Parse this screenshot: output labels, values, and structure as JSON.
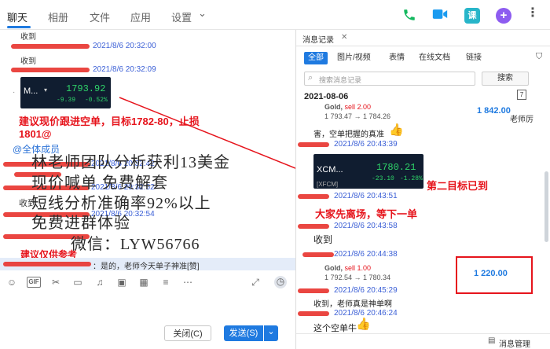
{
  "nav": {
    "tabs": [
      "聊天",
      "相册",
      "文件",
      "应用",
      "设置"
    ],
    "settings_caret": "⌄"
  },
  "top_icons": {
    "phone": "phone-icon",
    "video": "video-icon",
    "class": "课",
    "add": "+",
    "more": "more-icon",
    "accent_colors": {
      "phone": "#14b85f",
      "video": "#1a9bf0",
      "class": "#27b5c9",
      "add": "#8d5cf0"
    }
  },
  "chat": {
    "row1_msg": "收到",
    "row2_ts": "2021/8/6 20:32:00",
    "row3_msg": "收到",
    "row4_ts": "2021/8/6 20:32:09",
    "quote": {
      "symbol": "M...",
      "price": "1793.92",
      "change": "-9.39",
      "change_pct": "-0.52%"
    },
    "advice_line1": "建议现价跟进空单，目标1782-80，止损",
    "advice_line2": "1801@",
    "mention": "@全体成员",
    "ts_a": "2021/8/6 20:32:42",
    "ts_b": "2021/8/6 20:32:52",
    "msg_received": "收到",
    "ts_c": "2021/8/6 20:32:54",
    "suggestion_label": "建议仅供参考",
    "reply_preview": "：是的，老师今天单子神准[赞]"
  },
  "overlay": {
    "line1": "林老师团队分析获利13美金",
    "line2": "现价喊单     免费解套",
    "line3": "短线分析准确率92%以上",
    "line4": "免费进群体验",
    "line5": "微信：LYW56766"
  },
  "toolbar": {
    "gif_label": "GIF",
    "close_label": "关闭(C)",
    "send_label": "发送(S)",
    "send_caret": "⌄"
  },
  "panel": {
    "title": "消息记录",
    "close": "✕",
    "filters": [
      "全部",
      "图片/视频",
      "表情",
      "在线文档",
      "链接"
    ],
    "search_placeholder": "搜索消息记录",
    "search_button": "搜索",
    "date": "2021-08-06",
    "calendar_day": "7",
    "trade1": {
      "title": "Gold, ",
      "side": "sell 2.00",
      "detail": "1 793.47 → 1 784.26",
      "profit": "1 842.00",
      "tag": "老师厉"
    },
    "reply1": "害，空单把握的真准",
    "ts1": "2021/8/6 20:43:39",
    "chart": {
      "symbol": "XCM...",
      "bracket": "[XFCM]",
      "price": "1780.21",
      "change": "-23.10",
      "change_pct": "-1.28%"
    },
    "annotation_target": "第二目标已到",
    "annotation_leave": "大家先离场，等下一单",
    "ts2": "2021/8/6 20:43:51",
    "ts3": "2021/8/6 20:43:58",
    "msg_received": "收到",
    "ts4": "2021/8/6 20:44:38",
    "trade2": {
      "title": "Gold, ",
      "side": "sell 1.00",
      "detail": "1 792.54 → 1 780.34",
      "profit": "1 220.00"
    },
    "ts5": "2021/8/6 20:45:29",
    "reply2": "收到，老师真是神单啊",
    "ts6": "2021/8/6 20:46:24",
    "reply3": "这个空单牛",
    "msg_manage": "消息管理"
  }
}
